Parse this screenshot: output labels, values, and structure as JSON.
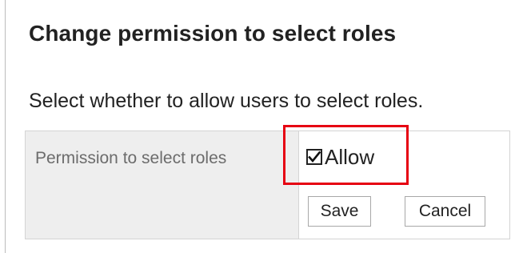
{
  "page": {
    "title": "Change permission to select roles",
    "description": "Select whether to allow users to select roles."
  },
  "settings": {
    "field_label": "Permission to select roles",
    "allow_label": "Allow",
    "allow_checked": true
  },
  "actions": {
    "save_label": "Save",
    "cancel_label": "Cancel"
  },
  "highlight": {
    "color": "#e60012"
  },
  "icons": {
    "checkbox": "checkmark-icon"
  }
}
